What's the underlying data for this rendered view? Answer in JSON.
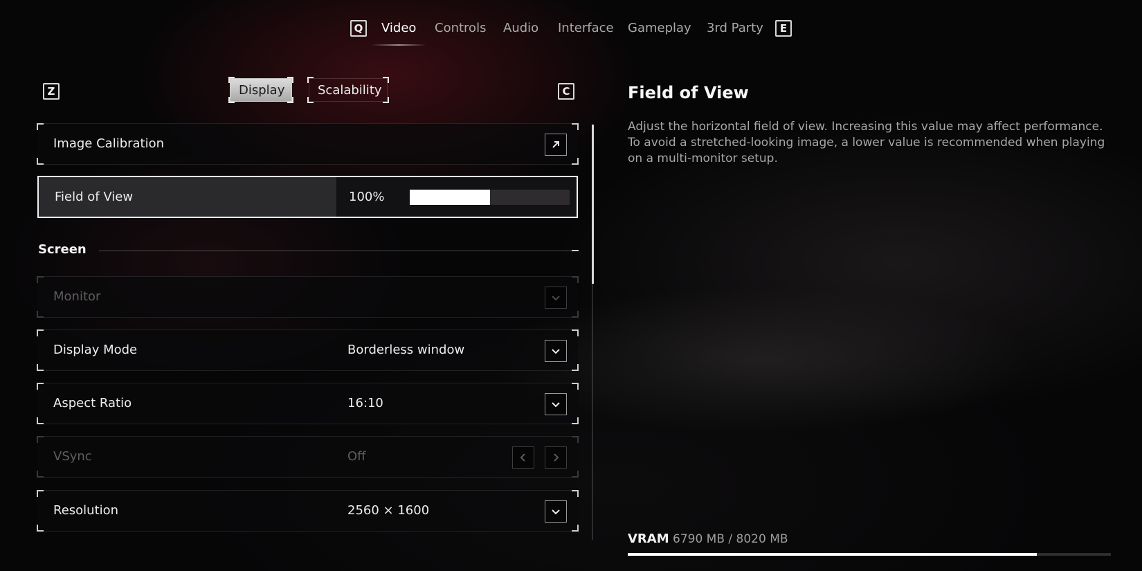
{
  "top_tabs": {
    "prev_key": "Q",
    "next_key": "E",
    "items": [
      {
        "label": "Video"
      },
      {
        "label": "Controls"
      },
      {
        "label": "Audio"
      },
      {
        "label": "Interface"
      },
      {
        "label": "Gameplay"
      },
      {
        "label": "3rd Party"
      }
    ],
    "active": "Video"
  },
  "sub_tabs": {
    "prev_key": "Z",
    "next_key": "C",
    "items": [
      {
        "label": "Display"
      },
      {
        "label": "Scalability"
      }
    ],
    "active": "Display"
  },
  "settings": {
    "image_calibration": {
      "label": "Image Calibration",
      "icon": "external-arrow-icon"
    },
    "field_of_view": {
      "label": "Field of View",
      "value": "100%",
      "slider_fraction": 0.5
    },
    "section_screen": "Screen",
    "monitor": {
      "label": "Monitor",
      "value": "",
      "disabled": true
    },
    "display_mode": {
      "label": "Display Mode",
      "value": "Borderless window"
    },
    "aspect_ratio": {
      "label": "Aspect Ratio",
      "value": "16:10"
    },
    "vsync": {
      "label": "VSync",
      "value": "Off",
      "disabled": true
    },
    "resolution": {
      "label": "Resolution",
      "value": "2560 × 1600"
    }
  },
  "detail": {
    "title": "Field of View",
    "description": "Adjust the horizontal field of view. Increasing this value may affect performance. To avoid a stretched-looking image, a lower value is recommended when playing on a multi-monitor setup."
  },
  "vram": {
    "label": "VRAM",
    "value": "6790 MB / 8020 MB",
    "used_fraction": 0.8466
  },
  "colors": {
    "accent": "#ffffff",
    "background": "#060607",
    "tint": "#60121a"
  }
}
